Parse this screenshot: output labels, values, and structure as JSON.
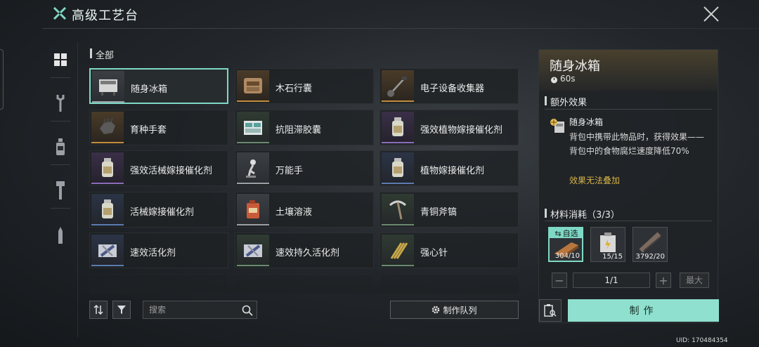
{
  "header": {
    "title": "高级工艺台",
    "logo_icon": "crossed-tools-icon",
    "close_icon": "close-icon"
  },
  "sidebar": {
    "items": [
      {
        "name": "grid-icon",
        "active": true
      },
      {
        "name": "wrench-icon",
        "active": false
      },
      {
        "name": "bottle-icon",
        "active": false
      },
      {
        "name": "tool-icon",
        "active": false
      },
      {
        "name": "bullet-icon",
        "active": false
      }
    ]
  },
  "category": {
    "label": "全部"
  },
  "items": [
    {
      "name": "随身冰箱",
      "quality": "white",
      "selected": true,
      "icon": "fridge-icon"
    },
    {
      "name": "木石行囊",
      "quality": "orange",
      "icon": "backpack-icon"
    },
    {
      "name": "电子设备收集器",
      "quality": "orange",
      "icon": "collector-icon"
    },
    {
      "name": "育种手套",
      "quality": "orange",
      "icon": "glove-icon"
    },
    {
      "name": "抗阻滞胶囊",
      "quality": "green",
      "icon": "capsule-icon"
    },
    {
      "name": "强效植物嫁接催化剂",
      "quality": "purple",
      "icon": "jar-icon"
    },
    {
      "name": "强效活械嫁接催化剂",
      "quality": "purple",
      "icon": "jar-icon"
    },
    {
      "name": "万能手",
      "quality": "white",
      "icon": "robot-arm-icon"
    },
    {
      "name": "植物嫁接催化剂",
      "quality": "blue",
      "icon": "jar-icon"
    },
    {
      "name": "活械嫁接催化剂",
      "quality": "blue",
      "icon": "jar-icon"
    },
    {
      "name": "土壤溶液",
      "quality": "white",
      "icon": "canister-icon"
    },
    {
      "name": "青铜斧镐",
      "quality": "green",
      "icon": "pickaxe-icon"
    },
    {
      "name": "速效活化剂",
      "quality": "blue",
      "icon": "syringe-icon"
    },
    {
      "name": "速效持久活化剂",
      "quality": "green",
      "icon": "syringe-icon"
    },
    {
      "name": "强心针",
      "quality": "green",
      "icon": "needles-icon"
    }
  ],
  "toolbar": {
    "sort_icon": "sort-icon",
    "filter_icon": "filter-icon",
    "search_placeholder": "搜索",
    "queue_label": "制作队列"
  },
  "detail": {
    "title": "随身冰箱",
    "time": "60s",
    "effect_section": "额外效果",
    "effect_name": "随身冰箱",
    "effect_desc": "背包中携带此物品时，获得效果——背包中的食物腐烂速度降低70%",
    "effect_note": "效果无法叠加",
    "materials_section": "材料消耗（3/3）",
    "auto_select": "自选",
    "materials": [
      {
        "icon": "copper-bar-icon",
        "count": "304/10",
        "selected": true
      },
      {
        "icon": "battery-box-icon",
        "count": "15/15",
        "selected": false
      },
      {
        "icon": "pipe-icon",
        "count": "3792/20",
        "selected": false
      }
    ],
    "quantity": "1/1",
    "max_label": "最大",
    "craft_label": "制作"
  },
  "uid": "UID: 170484354",
  "colors": {
    "accent": "#8fe0cf",
    "highlight": "#d6b24a"
  }
}
